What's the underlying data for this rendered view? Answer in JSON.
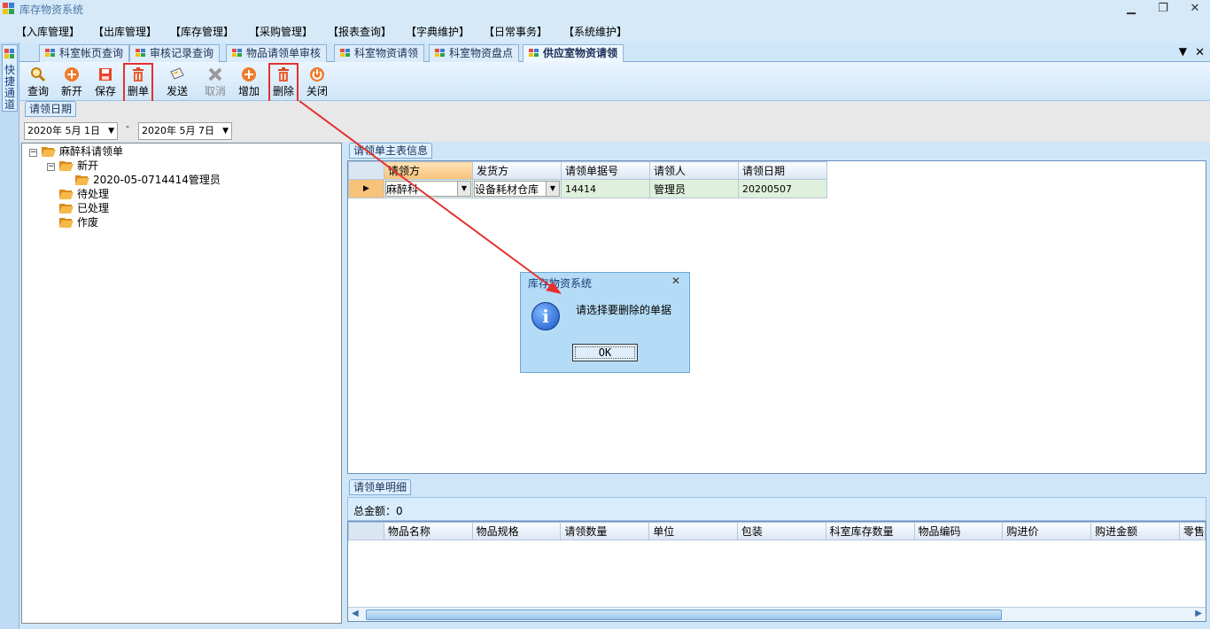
{
  "app": {
    "title": "库存物资系统"
  },
  "menu": [
    "【入库管理】",
    "【出库管理】",
    "【库存管理】",
    "【采购管理】",
    "【报表查询】",
    "【字典维护】",
    "【日常事务】",
    "【系统维护】"
  ],
  "quick_channel": {
    "label": "快捷通道"
  },
  "tabs": [
    "科室帐页查询",
    "审核记录查询",
    "物品请领单审核",
    "科室物资请领",
    "科室物资盘点",
    "供应室物资请领"
  ],
  "active_tab": "供应室物资请领",
  "toolbar": {
    "query": "查询",
    "new": "新开",
    "save": "保存",
    "delete_doc": "删单",
    "send": "发送",
    "cancel": "取消",
    "add": "增加",
    "delete": "删除",
    "close": "关闭"
  },
  "date_group": {
    "label": "请领日期",
    "start": "2020年 5月 1日",
    "separator": "-",
    "end": "2020年 5月 7日"
  },
  "tree": {
    "root": "麻醉科请领单",
    "new": "新开",
    "new_child": "2020-05-0714414管理员",
    "pending": "待处理",
    "processed": "已处理",
    "voided": "作废"
  },
  "master": {
    "label": "请领单主表信息",
    "columns": [
      "请领方",
      "发货方",
      "请领单据号",
      "请领人",
      "请领日期"
    ],
    "row": {
      "requester": "麻醉科",
      "shipper": "设备耗材仓库",
      "doc_no": "14414",
      "person": "管理员",
      "date": "20200507"
    }
  },
  "detail": {
    "label": "请领单明细",
    "total_label": "总金额：0",
    "columns": [
      "物品名称",
      "物品规格",
      "请领数量",
      "单位",
      "包装",
      "科室库存数量",
      "物品编码",
      "购进价",
      "购进金额",
      "零售"
    ]
  },
  "dialog": {
    "title": "库存物资系统",
    "message": "请选择要删除的单据",
    "ok": "OK",
    "close": "✕"
  },
  "colors": {
    "highlight": "#e53030",
    "accent": "#2f6fb3",
    "header_bg": "#d6e9f8"
  }
}
